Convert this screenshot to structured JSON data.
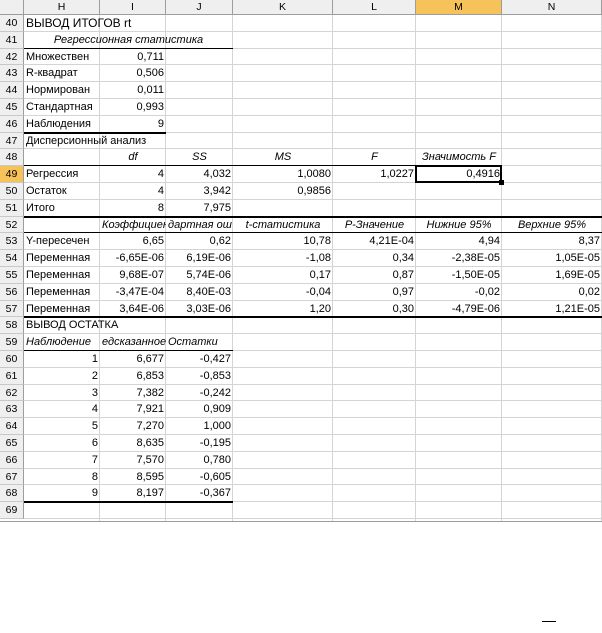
{
  "columns": [
    "H",
    "I",
    "J",
    "K",
    "L",
    "M",
    "N"
  ],
  "selected_column": "M",
  "selected_row": "49",
  "rows": [
    {
      "n": "40",
      "cells": {
        "H": "ВЫВОД ИТОГОВ rt"
      }
    },
    {
      "n": "41",
      "cells": {
        "H": "Регрессионная статистика"
      }
    },
    {
      "n": "42",
      "cells": {
        "H": "Множествен",
        "I": "0,711"
      }
    },
    {
      "n": "43",
      "cells": {
        "H": "R-квадрат",
        "I": "0,506"
      }
    },
    {
      "n": "44",
      "cells": {
        "H": "Нормирован",
        "I": "0,011"
      }
    },
    {
      "n": "45",
      "cells": {
        "H": "Стандартная",
        "I": "0,993"
      }
    },
    {
      "n": "46",
      "cells": {
        "H": "Наблюдения",
        "I": "9"
      }
    },
    {
      "n": "47",
      "cells": {
        "H": "Дисперсионный анализ"
      }
    },
    {
      "n": "48",
      "cells": {
        "I": "df",
        "J": "SS",
        "K": "MS",
        "L": "F",
        "M": "Значимость F"
      }
    },
    {
      "n": "49",
      "cells": {
        "H": "Регрессия",
        "I": "4",
        "J": "4,032",
        "K": "1,0080",
        "L": "1,0227",
        "M": "0,4916"
      }
    },
    {
      "n": "50",
      "cells": {
        "H": "Остаток",
        "I": "4",
        "J": "3,942",
        "K": "0,9856"
      }
    },
    {
      "n": "51",
      "cells": {
        "H": "Итого",
        "I": "8",
        "J": "7,975"
      }
    },
    {
      "n": "52",
      "cells": {
        "H": "",
        "I": "Коэффициент",
        "J": "дартная ош",
        "K": "t-статистика",
        "L": "P-Значение",
        "M": "Нижние 95%",
        "N": "Верхние 95%"
      }
    },
    {
      "n": "53",
      "cells": {
        "H": "Y-пересечен",
        "I": "6,65",
        "J": "0,62",
        "K": "10,78",
        "L": "4,21E-04",
        "M": "4,94",
        "N": "8,37"
      }
    },
    {
      "n": "54",
      "cells": {
        "H": "Переменная",
        "I": "-6,65E-06",
        "J": "6,19E-06",
        "K": "-1,08",
        "L": "0,34",
        "M": "-2,38E-05",
        "N": "1,05E-05"
      }
    },
    {
      "n": "55",
      "cells": {
        "H": "Переменная",
        "I": "9,68E-07",
        "J": "5,74E-06",
        "K": "0,17",
        "L": "0,87",
        "M": "-1,50E-05",
        "N": "1,69E-05"
      }
    },
    {
      "n": "56",
      "cells": {
        "H": "Переменная",
        "I": "-3,47E-04",
        "J": "8,40E-03",
        "K": "-0,04",
        "L": "0,97",
        "M": "-0,02",
        "N": "0,02"
      }
    },
    {
      "n": "57",
      "cells": {
        "H": "Переменная",
        "I": "3,64E-06",
        "J": "3,03E-06",
        "K": "1,20",
        "L": "0,30",
        "M": "-4,79E-06",
        "N": "1,21E-05"
      }
    },
    {
      "n": "58",
      "cells": {
        "H": "ВЫВОД ОСТАТКА"
      }
    },
    {
      "n": "59",
      "cells": {
        "H": "Наблюдение",
        "I": "едсказанное",
        "J": "Остатки"
      }
    },
    {
      "n": "60",
      "cells": {
        "H": "1",
        "I": "6,677",
        "J": "-0,427"
      }
    },
    {
      "n": "61",
      "cells": {
        "H": "2",
        "I": "6,853",
        "J": "-0,853"
      }
    },
    {
      "n": "62",
      "cells": {
        "H": "3",
        "I": "7,382",
        "J": "-0,242"
      }
    },
    {
      "n": "63",
      "cells": {
        "H": "4",
        "I": "7,921",
        "J": "0,909"
      }
    },
    {
      "n": "64",
      "cells": {
        "H": "5",
        "I": "7,270",
        "J": "1,000"
      }
    },
    {
      "n": "65",
      "cells": {
        "H": "6",
        "I": "8,635",
        "J": "-0,195"
      }
    },
    {
      "n": "66",
      "cells": {
        "H": "7",
        "I": "7,570",
        "J": "0,780"
      }
    },
    {
      "n": "67",
      "cells": {
        "H": "8",
        "I": "8,595",
        "J": "-0,605"
      }
    },
    {
      "n": "68",
      "cells": {
        "H": "9",
        "I": "8,197",
        "J": "-0,367"
      }
    },
    {
      "n": "69",
      "cells": {}
    }
  ]
}
